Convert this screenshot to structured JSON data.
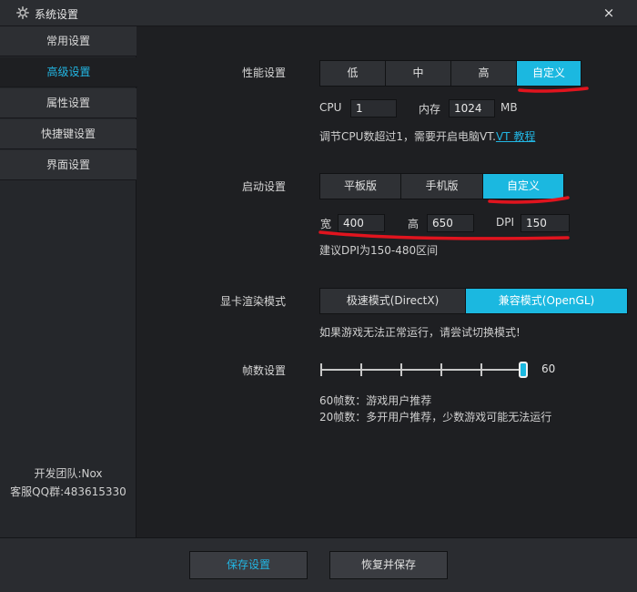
{
  "window": {
    "title": "系统设置",
    "close_symbol": "×"
  },
  "sidebar": {
    "items": [
      {
        "label": "常用设置",
        "active": false
      },
      {
        "label": "高级设置",
        "active": true
      },
      {
        "label": "属性设置",
        "active": false
      },
      {
        "label": "快捷键设置",
        "active": false
      },
      {
        "label": "界面设置",
        "active": false
      }
    ],
    "footer": {
      "team": "开发团队:Nox",
      "qq": "客服QQ群:483615330"
    }
  },
  "performance": {
    "label": "性能设置",
    "options": [
      "低",
      "中",
      "高",
      "自定义"
    ],
    "selected": "自定义",
    "cpu_label": "CPU",
    "cpu_value": "1",
    "memory_label": "内存",
    "memory_value": "1024",
    "memory_unit": "MB",
    "hint_prefix": "调节CPU数超过1，需要开启电脑VT.",
    "hint_link": "VT 教程"
  },
  "startup": {
    "label": "启动设置",
    "options": [
      "平板版",
      "手机版",
      "自定义"
    ],
    "selected": "自定义",
    "width_label": "宽",
    "width_value": "400",
    "height_label": "高",
    "height_value": "650",
    "dpi_label": "DPI",
    "dpi_value": "150",
    "hint": "建议DPI为150-480区间"
  },
  "render": {
    "label": "显卡渲染模式",
    "options": [
      "极速模式(DirectX)",
      "兼容模式(OpenGL)"
    ],
    "selected": "兼容模式(OpenGL)",
    "hint": "如果游戏无法正常运行，请尝试切换模式!"
  },
  "fps": {
    "label": "帧数设置",
    "value": "60",
    "slider_fraction": 1.0,
    "hint1": "60帧数：游戏用户推荐",
    "hint2": "20帧数：多开用户推荐，少数游戏可能无法运行"
  },
  "buttons": {
    "save": "保存设置",
    "restore": "恢复并保存"
  },
  "colors": {
    "accent": "#1bb8e0",
    "link": "#22b6e3",
    "annotation": "#e0141e"
  }
}
